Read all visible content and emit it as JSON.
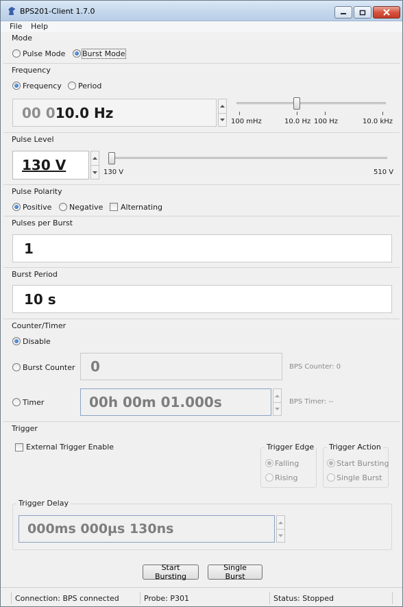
{
  "window": {
    "title": "BPS201-Client 1.7.0",
    "app_icon": "horse-logo-icon"
  },
  "menu": {
    "file": "File",
    "help": "Help"
  },
  "mode": {
    "label": "Mode",
    "pulse_mode": "Pulse Mode",
    "burst_mode": "Burst Mode",
    "selected": "burst_mode"
  },
  "frequency": {
    "label": "Frequency",
    "opt_frequency": "Frequency",
    "opt_period": "Period",
    "selected": "frequency",
    "value_prefix": "00 0",
    "value_main": "10.0 Hz",
    "ticks": [
      "100 mHz",
      "10.0 Hz",
      "100 Hz",
      "10.0 kHz"
    ],
    "slider_fraction": 0.4
  },
  "pulse_level": {
    "label": "Pulse Level",
    "value": "130 V",
    "min_label": "130 V",
    "max_label": "510 V",
    "slider_fraction": 0.0
  },
  "polarity": {
    "label": "Pulse Polarity",
    "positive": "Positive",
    "negative": "Negative",
    "alternating": "Alternating",
    "selected": "positive",
    "alternating_checked": false
  },
  "pulses_per_burst": {
    "label": "Pulses per Burst",
    "value": "1"
  },
  "burst_period": {
    "label": "Burst Period",
    "value": "10 s"
  },
  "counter_timer": {
    "label": "Counter/Timer",
    "disable": "Disable",
    "burst_counter": "Burst Counter",
    "timer": "Timer",
    "selected": "disable",
    "counter_value": "0",
    "counter_status": "BPS Counter: 0",
    "timer_value": "00h 00m 01.000s",
    "timer_status": "BPS Timer: --"
  },
  "trigger": {
    "label": "Trigger",
    "external_enable": "External Trigger Enable",
    "external_checked": false,
    "edge": {
      "title": "Trigger Edge",
      "falling": "Falling",
      "rising": "Rising",
      "selected": "falling"
    },
    "action": {
      "title": "Trigger Action",
      "start": "Start Bursting",
      "single": "Single Burst",
      "selected": "start"
    },
    "delay": {
      "title": "Trigger Delay",
      "value": "000ms 000µs 130ns"
    }
  },
  "buttons": {
    "start": "Start Bursting",
    "single": "Single Burst"
  },
  "status": {
    "connection": "Connection: BPS connected",
    "probe": "Probe: P301",
    "state": "Status: Stopped"
  },
  "colors": {
    "accent": "#2a5ea8",
    "title_bar": "#c4d7ec",
    "close_button": "#c43b26"
  }
}
